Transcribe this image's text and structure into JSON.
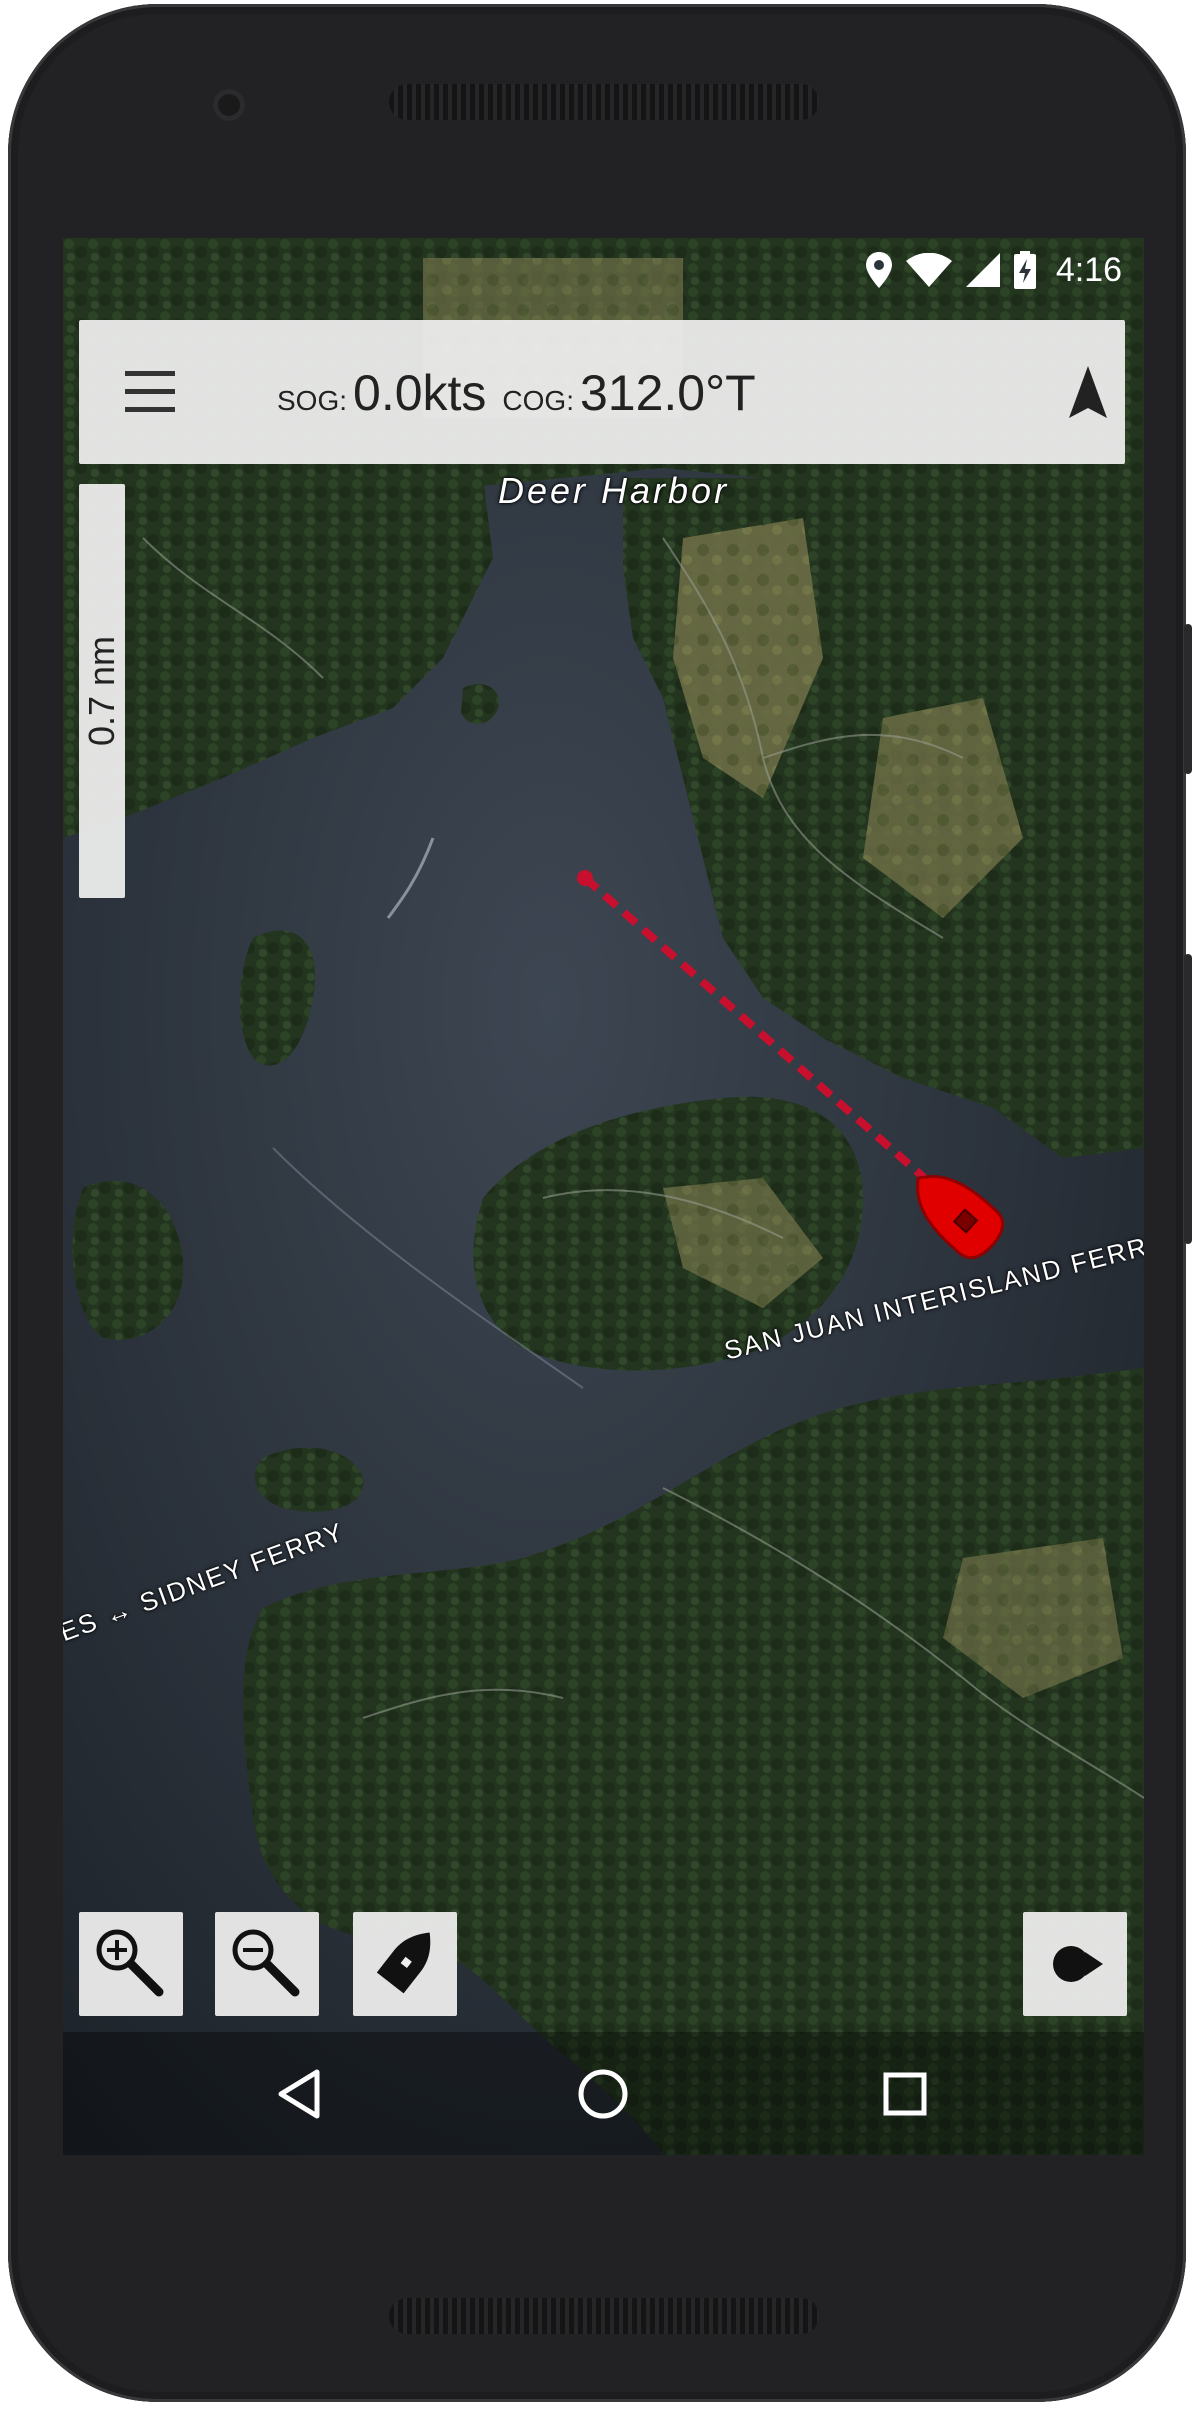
{
  "status_bar": {
    "time": "4:16",
    "icons": [
      "location-icon",
      "wifi-icon",
      "cell-signal-icon",
      "battery-charging-icon"
    ]
  },
  "top_bar": {
    "menu_icon": "hamburger-menu-icon",
    "sog_label": "SOG:",
    "sog_value": "0.0kts",
    "cog_label": "COG:",
    "cog_value": "312.0°T",
    "north_icon": "north-arrow-icon"
  },
  "scale_bar": {
    "label": "0.7 nm"
  },
  "map": {
    "place_labels": [
      "Deer Harbor"
    ],
    "route_labels": [
      "SAN JUAN INTERISLAND FERR",
      "ES ↔ SIDNEY FERRY"
    ],
    "vessel_color": "#e00000",
    "heading_line_color": "#c8102e"
  },
  "controls": {
    "zoom_in_icon": "zoom-in-icon",
    "zoom_out_icon": "zoom-out-icon",
    "center_boat_icon": "boat-icon",
    "record_icon": "record-track-icon"
  },
  "nav_bar": {
    "icons": [
      "back-icon",
      "home-icon",
      "recents-icon"
    ]
  }
}
